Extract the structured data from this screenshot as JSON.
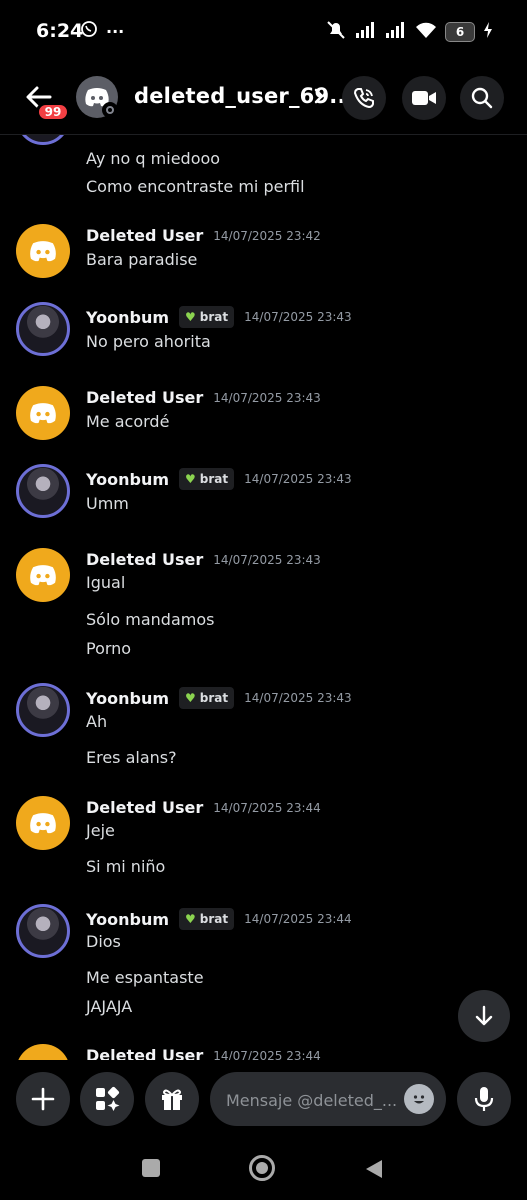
{
  "status_bar": {
    "time": "6:24",
    "dots": "···",
    "battery_level": "6"
  },
  "header": {
    "unread_badge": "99",
    "channel_name": "deleted_user_69..."
  },
  "messages": {
    "g0": {
      "lines": [
        "Ay no q miedooo",
        "Como encontraste mi perfil"
      ]
    },
    "g1": {
      "author": "Deleted User",
      "timestamp": "14/07/2025 23:42",
      "lines": [
        "Bara paradise"
      ]
    },
    "g2": {
      "author": "Yoonbum",
      "tag": "brat",
      "timestamp": "14/07/2025 23:43",
      "lines": [
        "No pero ahorita"
      ]
    },
    "g3": {
      "author": "Deleted User",
      "timestamp": "14/07/2025 23:43",
      "lines": [
        "Me acordé"
      ]
    },
    "g4": {
      "author": "Yoonbum",
      "tag": "brat",
      "timestamp": "14/07/2025 23:43",
      "lines": [
        "Umm"
      ]
    },
    "g5": {
      "author": "Deleted User",
      "timestamp": "14/07/2025 23:43",
      "lines": [
        "Igual",
        "Sólo mandamos",
        "Porno"
      ]
    },
    "g6": {
      "author": "Yoonbum",
      "tag": "brat",
      "timestamp": "14/07/2025 23:43",
      "lines": [
        "Ah",
        "Eres alans?"
      ]
    },
    "g7": {
      "author": "Deleted User",
      "timestamp": "14/07/2025 23:44",
      "lines": [
        "Jeje",
        "Si mi niño"
      ]
    },
    "g8": {
      "author": "Yoonbum",
      "tag": "brat",
      "timestamp": "14/07/2025 23:44",
      "lines": [
        "Dios",
        "Me espantaste",
        "JAJAJA"
      ]
    },
    "g9": {
      "author": "Deleted User",
      "timestamp": "14/07/2025 23:44"
    }
  },
  "composer": {
    "placeholder": "Mensaje @deleted_..."
  },
  "icons": {
    "back": "arrow-left-icon",
    "call": "phone-call-icon",
    "video": "video-camera-icon",
    "search": "search-icon",
    "plus": "plus-icon",
    "apps": "apps-icon",
    "gift": "gift-icon",
    "emoji": "emoji-icon",
    "mic": "microphone-icon",
    "jump": "arrow-down-icon"
  },
  "colors": {
    "accent_orange": "#f0a91c",
    "badge_red": "#f23f43",
    "background": "#000000",
    "tag_heart": "#8bd450"
  }
}
